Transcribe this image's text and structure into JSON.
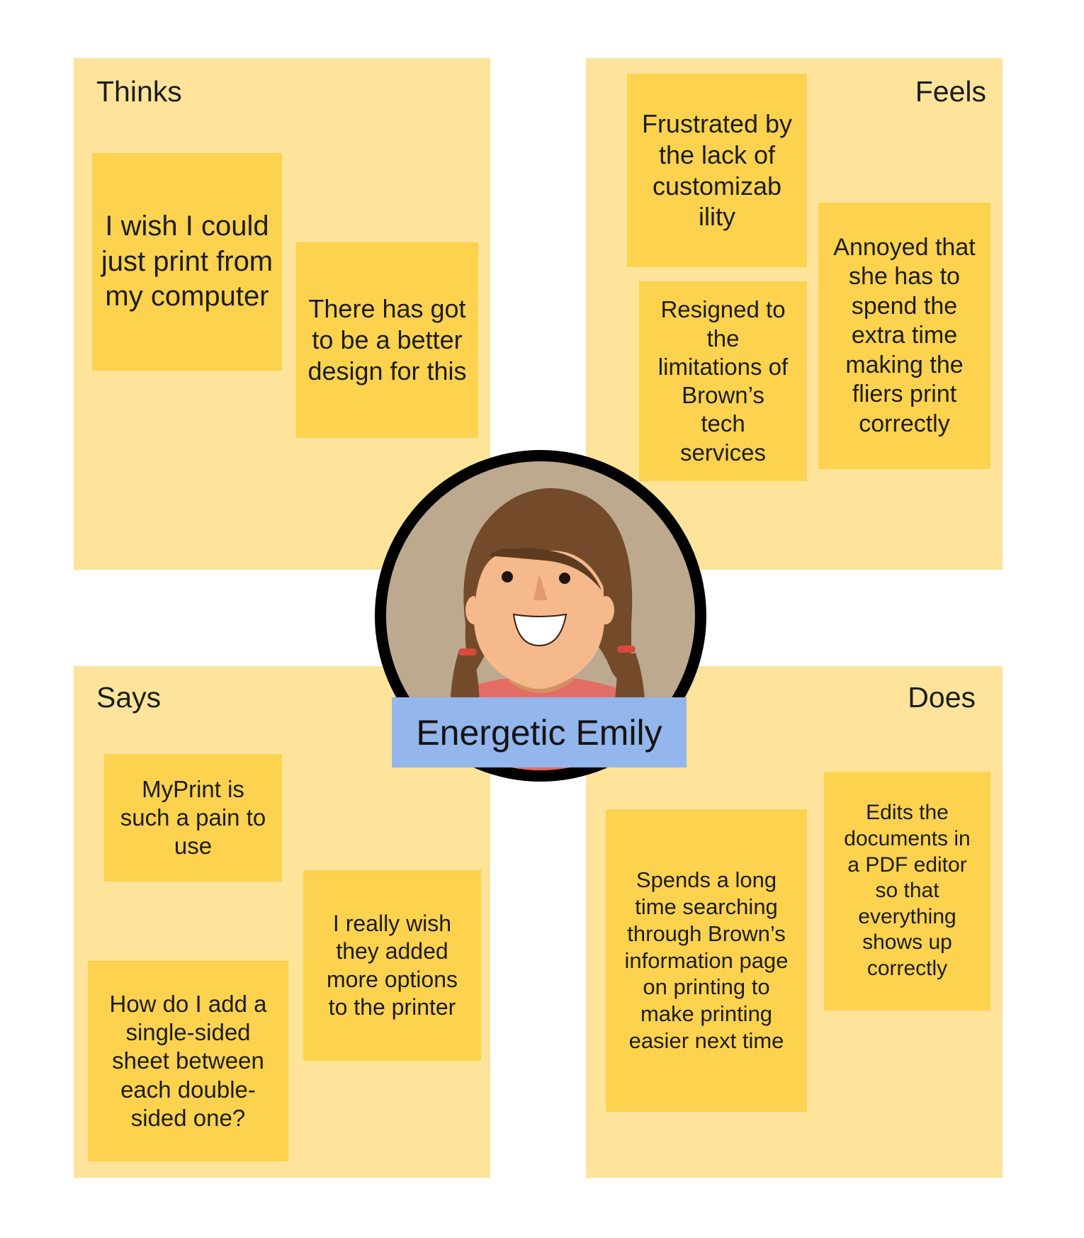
{
  "thinks": {
    "title": "Thinks",
    "notes": [
      "I wish I could just print from my computer",
      "There has got to be a better design for this"
    ]
  },
  "feels": {
    "title": "Feels",
    "notes": [
      "Frustrated by the lack of customizab ility",
      "Resigned to the limitations of Brown’s tech services",
      "Annoyed that she has to spend the extra time making the fliers print correctly"
    ]
  },
  "says": {
    "title": "Says",
    "notes": [
      "MyPrint is such a pain to use",
      "I really wish they added more options to the printer",
      "How do I add a single-sided sheet between each double-sided one?"
    ]
  },
  "does": {
    "title": "Does",
    "notes": [
      "Spends a long time searching through Brown’s information page on printing to make printing easier next time",
      "Edits the documents in a PDF editor so that everything shows up correctly"
    ]
  },
  "persona": {
    "name": "Energetic Emily",
    "avatar_icon": "smiling-girl-avatar-icon"
  },
  "colors": {
    "quadrant": "#fde49a",
    "sticky": "#fdd24f",
    "name_banner": "#93b6ec",
    "avatar_ring": "#000000",
    "avatar_background": "#bca98f",
    "hair": "#734b2a",
    "skin": "#f5b98b"
  }
}
